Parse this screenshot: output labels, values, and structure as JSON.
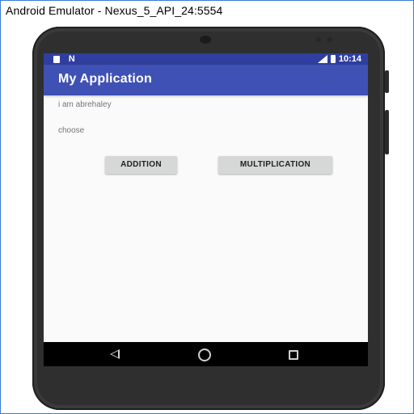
{
  "window": {
    "title": "Android Emulator - Nexus_5_API_24:5554"
  },
  "status_bar": {
    "left_icons": [
      "sd-card-icon",
      "n-icon"
    ],
    "n_label": "N",
    "right_icons": [
      "signal-icon",
      "battery-icon"
    ],
    "time": "10:14"
  },
  "app": {
    "title": "My Application",
    "text1": "i am abrehaley",
    "text2": "choose",
    "buttons": {
      "addition": "ADDITION",
      "multiplication": "MULTIPLICATION"
    }
  },
  "nav_bar": {
    "icons": [
      "back-icon",
      "home-icon",
      "recents-icon"
    ]
  },
  "colors": {
    "status_bar": "#303f9f",
    "toolbar": "#3f51b5",
    "screen_bg": "#fafafa",
    "button_bg": "#d6d7d7"
  }
}
